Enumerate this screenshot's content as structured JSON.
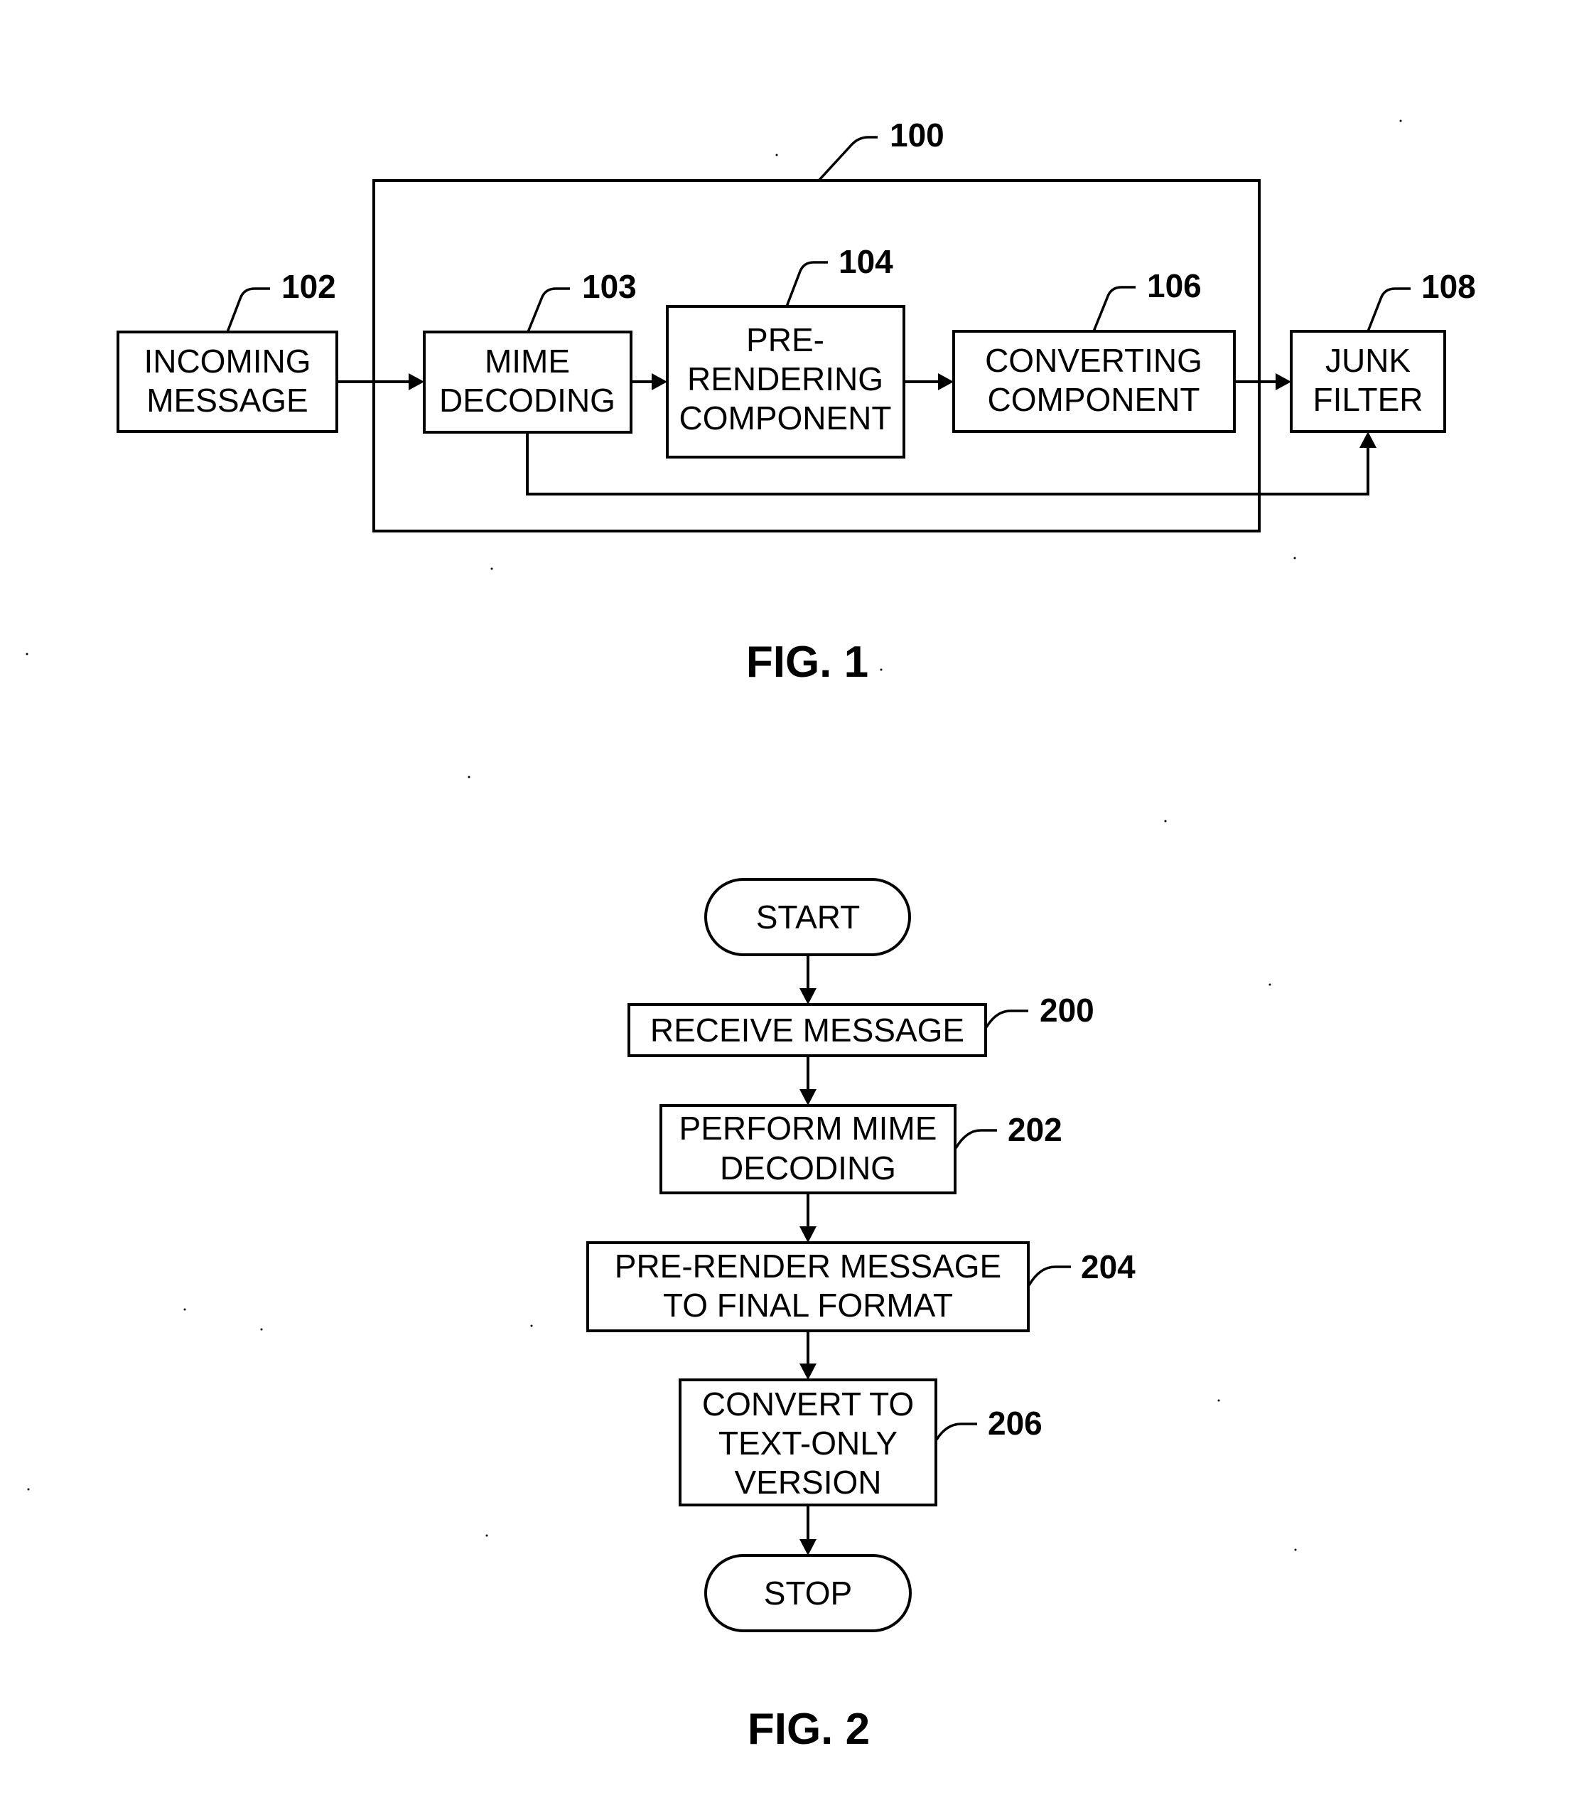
{
  "figure1": {
    "caption": "FIG. 1",
    "system": {
      "ref": "100"
    },
    "blocks": [
      {
        "id": "incoming-message",
        "ref": "102",
        "lines": [
          "INCOMING",
          "MESSAGE"
        ]
      },
      {
        "id": "mime-decoding",
        "ref": "103",
        "lines": [
          "MIME",
          "DECODING"
        ]
      },
      {
        "id": "pre-rendering-component",
        "ref": "104",
        "lines": [
          "PRE-",
          "RENDERING",
          "COMPONENT"
        ]
      },
      {
        "id": "converting-component",
        "ref": "106",
        "lines": [
          "CONVERTING",
          "COMPONENT"
        ]
      },
      {
        "id": "junk-filter",
        "ref": "108",
        "lines": [
          "JUNK",
          "FILTER"
        ]
      }
    ],
    "connections": [
      {
        "from": "incoming-message",
        "to": "mime-decoding"
      },
      {
        "from": "mime-decoding",
        "to": "pre-rendering-component"
      },
      {
        "from": "pre-rendering-component",
        "to": "converting-component"
      },
      {
        "from": "converting-component",
        "to": "junk-filter"
      },
      {
        "from": "mime-decoding",
        "to": "junk-filter",
        "route": "bypass-below"
      }
    ]
  },
  "figure2": {
    "caption": "FIG. 2",
    "start": {
      "label": "START"
    },
    "steps": [
      {
        "id": "receive-message",
        "ref": "200",
        "lines": [
          "RECEIVE MESSAGE"
        ]
      },
      {
        "id": "perform-mime-decoding",
        "ref": "202",
        "lines": [
          "PERFORM MIME",
          "DECODING"
        ]
      },
      {
        "id": "pre-render-message",
        "ref": "204",
        "lines": [
          "PRE-RENDER MESSAGE",
          "TO FINAL FORMAT"
        ]
      },
      {
        "id": "convert-to-text-only",
        "ref": "206",
        "lines": [
          "CONVERT TO",
          "TEXT-ONLY",
          "VERSION"
        ]
      }
    ],
    "stop": {
      "label": "STOP"
    }
  }
}
